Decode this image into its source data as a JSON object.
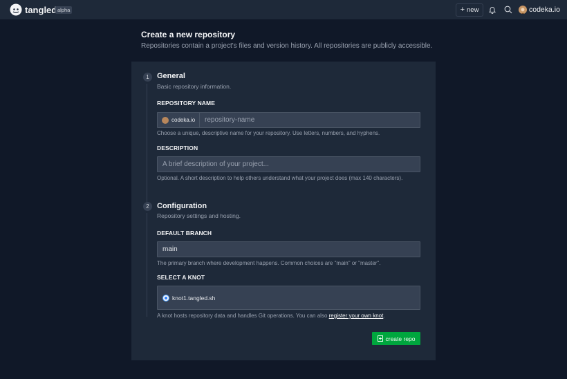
{
  "nav": {
    "brand": "tangled",
    "badge": "alpha",
    "new_label": "new",
    "username": "codeka.io"
  },
  "header": {
    "title": "Create a new repository",
    "subtitle": "Repositories contain a project's files and version history. All repositories are publicly accessible."
  },
  "general": {
    "step": "1",
    "title": "General",
    "subtitle": "Basic repository information.",
    "repo_name_label": "REPOSITORY NAME",
    "owner_prefix": "codeka.io",
    "repo_name_placeholder": "repository-name",
    "repo_name_help": "Choose a unique, descriptive name for your repository. Use letters, numbers, and hyphens.",
    "description_label": "DESCRIPTION",
    "description_placeholder": "A brief description of your project...",
    "description_help": "Optional. A short description to help others understand what your project does (max 140 characters)."
  },
  "configuration": {
    "step": "2",
    "title": "Configuration",
    "subtitle": "Repository settings and hosting.",
    "branch_label": "DEFAULT BRANCH",
    "branch_value": "main",
    "branch_help": "The primary branch where development happens. Common choices are \"main\" or \"master\".",
    "knot_label": "SELECT A KNOT",
    "knot_option": "knot1.tangled.sh",
    "knot_help_prefix": "A knot hosts repository data and handles Git operations. You can also ",
    "knot_help_link": "register your own knot",
    "knot_help_suffix": "."
  },
  "actions": {
    "create_label": "create repo"
  },
  "colors": {
    "background": "#101828",
    "card": "#1e2939",
    "input": "#364153",
    "accent_green": "#00a63e",
    "radio_blue": "#2b7fff"
  }
}
